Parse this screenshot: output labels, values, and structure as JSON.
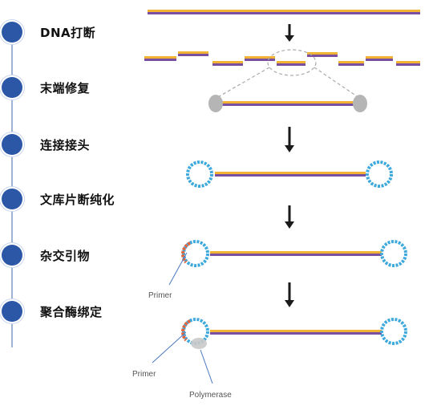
{
  "steps": [
    {
      "label": "DNA打断"
    },
    {
      "label": "末端修复"
    },
    {
      "label": "连接接头"
    },
    {
      "label": "文库片断纯化"
    },
    {
      "label": "杂交引物"
    },
    {
      "label": "聚合酶绑定"
    }
  ],
  "annotations": {
    "primer_1": "Primer",
    "primer_2": "Primer",
    "polymerase": "Polymerase"
  },
  "colors": {
    "step_dot": "#2b57a6",
    "strand_top": "#f2b233",
    "strand_bottom": "#7a4fa0",
    "adapter": "#3ea9dc",
    "primer": "#e8643c",
    "arrow": "#1a1a1a",
    "annotation_line": "#4a78c0"
  }
}
